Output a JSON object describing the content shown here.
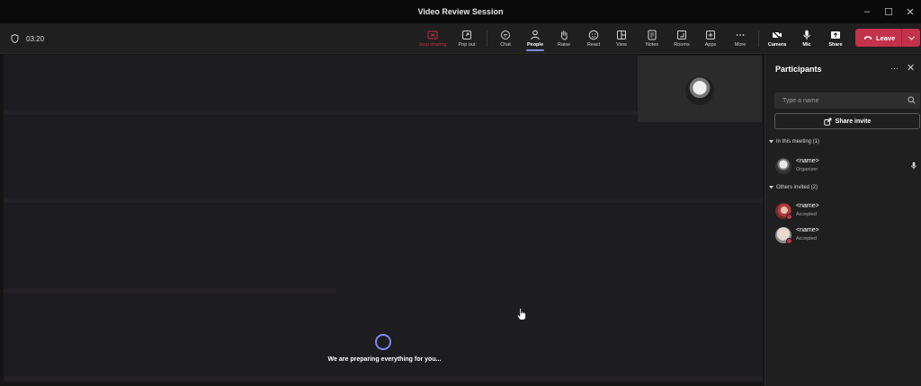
{
  "window": {
    "title": "Video Review Session",
    "controls": [
      "–",
      "☐",
      "✕"
    ]
  },
  "toolbar": {
    "timer": "03:20",
    "buttons": {
      "stop_sharing": "Stop sharing",
      "pop_out": "Pop out",
      "chat": "Chat",
      "people": "People",
      "raise": "Raise",
      "react": "React",
      "view": "View",
      "notes": "Notes",
      "rooms": "Rooms",
      "apps": "Apps",
      "more": "More",
      "camera": "Camera",
      "mic": "Mic",
      "share": "Share"
    },
    "leave_label": "Leave",
    "active_tab": "people"
  },
  "stage": {
    "status_text": "We are preparing everything for you..."
  },
  "participants": {
    "title": "Participants",
    "search_placeholder": "Type a name",
    "share_invite_label": "Share invite",
    "in_meeting_header": "In this meeting (1)",
    "in_meeting": [
      {
        "name": "<name>",
        "role": "Organizer"
      }
    ],
    "others_header": "Others invited (2)",
    "others": [
      {
        "name": "<name>",
        "status": "Accepted"
      },
      {
        "name": "<name>",
        "status": "Accepted"
      }
    ]
  },
  "colors": {
    "accent": "#7f85f5",
    "leave": "#c4314b",
    "background": "#1d1c1f"
  }
}
